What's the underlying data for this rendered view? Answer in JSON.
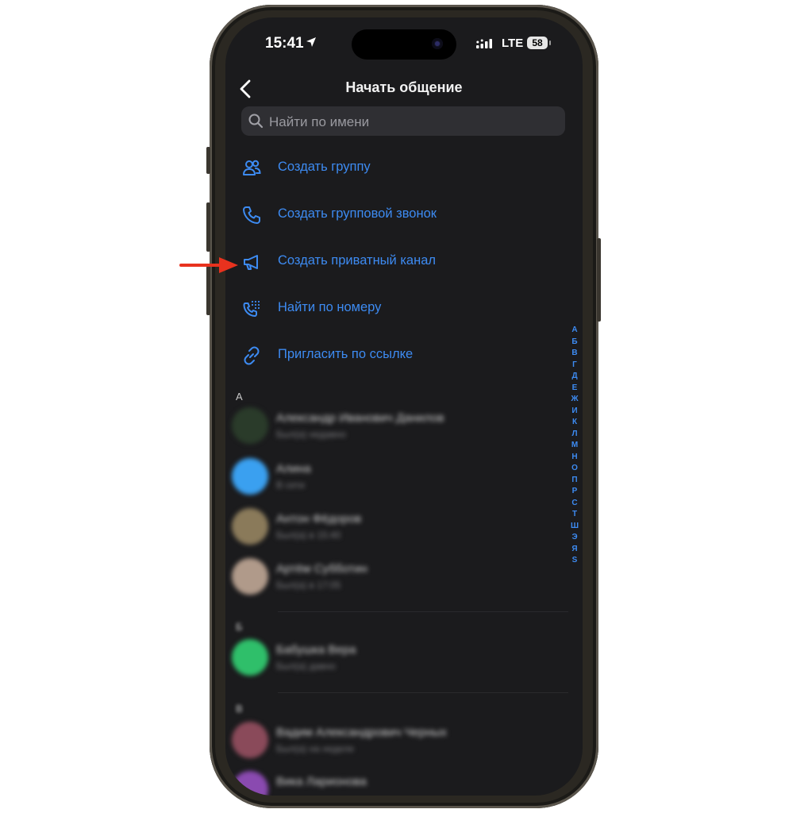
{
  "status_bar": {
    "time": "15:41",
    "network": "LTE",
    "battery": "58"
  },
  "header": {
    "title": "Начать общение"
  },
  "search": {
    "placeholder": "Найти по имени",
    "value": ""
  },
  "actions": [
    {
      "label": "Создать группу",
      "icon": "group-icon"
    },
    {
      "label": "Создать групповой звонок",
      "icon": "phone-icon"
    },
    {
      "label": "Создать приватный канал",
      "icon": "megaphone-icon"
    },
    {
      "label": "Найти по номеру",
      "icon": "dialpad-phone-icon"
    },
    {
      "label": "Пригласить по ссылке",
      "icon": "link-icon"
    }
  ],
  "sections": [
    {
      "letter": "А",
      "contacts": [
        {
          "name": "Александр Иванович Данилов",
          "sub": "Был(а) недавно",
          "color": "#2a3b2a"
        },
        {
          "name": "Алина",
          "sub": "В сети",
          "color": "#3aa0f0"
        },
        {
          "name": "Антон Фёдоров",
          "sub": "Был(а) в 15:40",
          "color": "#8a7a5a"
        },
        {
          "name": "Артём Субботин",
          "sub": "Был(а) в 17:05",
          "color": "#b09a8a"
        }
      ]
    },
    {
      "letter": "Б",
      "contacts": [
        {
          "name": "Бабушка Вера",
          "sub": "Был(а) давно",
          "color": "#2fbf6a"
        }
      ]
    },
    {
      "letter": "В",
      "contacts": [
        {
          "name": "Вадим Александрович Черных",
          "sub": "Был(а) на неделе",
          "color": "#8a4a5a"
        },
        {
          "name": "Вика Ларионова",
          "sub": "",
          "color": "#8a4ab0"
        }
      ]
    }
  ],
  "alphabet_index": [
    "А",
    "Б",
    "В",
    "Г",
    "Д",
    "Е",
    "Ж",
    "И",
    "К",
    "Л",
    "М",
    "Н",
    "О",
    "П",
    "Р",
    "С",
    "Т",
    "Ш",
    "Э",
    "Я",
    "S"
  ],
  "colors": {
    "accent": "#3d8bf2",
    "background": "#1b1b1d",
    "arrow": "#e8321e"
  }
}
